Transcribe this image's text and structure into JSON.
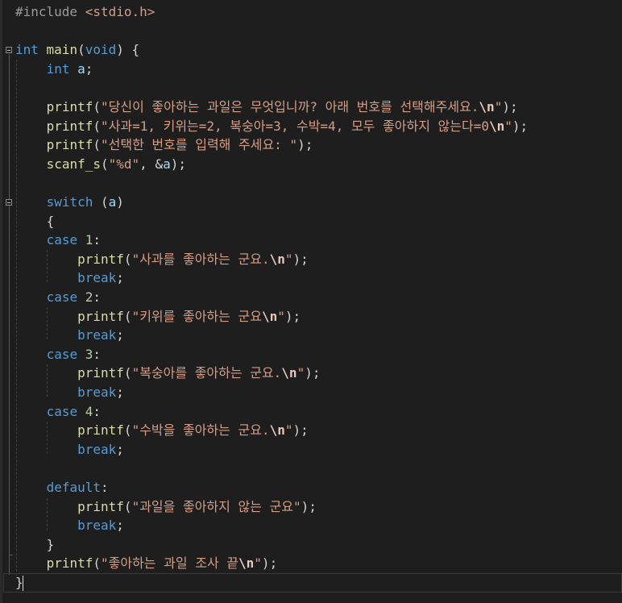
{
  "editor": {
    "language": "C",
    "lines": [
      "#include <stdio.h>",
      "",
      "int main(void) {",
      "    int a;",
      "",
      "    printf(\"당신이 좋아하는 과일은 무엇입니까? 아래 번호를 선택해주세요.\\n\");",
      "    printf(\"사과=1, 키위는=2, 복숭아=3, 수박=4, 모두 좋아하지 않는다=0\\n\");",
      "    printf(\"선택한 번호를 입력해 주세요: \");",
      "    scanf_s(\"%d\", &a);",
      "",
      "    switch (a)",
      "    {",
      "    case 1:",
      "        printf(\"사과를 좋아하는 군요.\\n\");",
      "        break;",
      "    case 2:",
      "        printf(\"키위를 좋아하는 군요\\n\");",
      "        break;",
      "    case 3:",
      "        printf(\"복숭아를 좋아하는 군요.\\n\");",
      "        break;",
      "    case 4:",
      "        printf(\"수박을 좋아하는 군요.\\n\");",
      "        break;",
      "",
      "    default:",
      "        printf(\"과일을 좋아하지 않는 군요\");",
      "        break;",
      "    }",
      "    printf(\"좋아하는 과일 조사 끝\\n\");",
      "}"
    ]
  },
  "theme": {
    "background": "#1e1e1e",
    "keyword": "#569cd6",
    "function": "#dcdcaa",
    "string": "#d69d85",
    "variable": "#9cdcfe",
    "number": "#b5cea8",
    "preprocessor": "#9b9b9b"
  }
}
